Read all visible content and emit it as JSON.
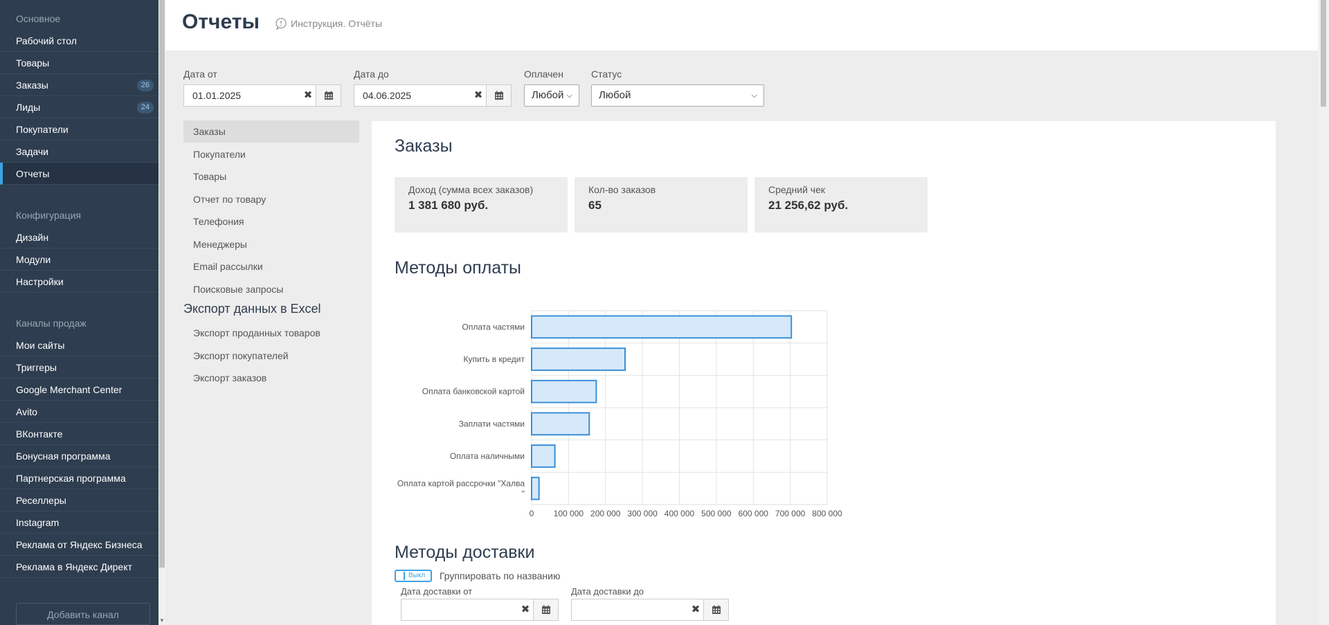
{
  "sidebar": {
    "sections": [
      {
        "title": "Основное",
        "items": [
          {
            "label": "Рабочий стол"
          },
          {
            "label": "Товары"
          },
          {
            "label": "Заказы",
            "badge": "26"
          },
          {
            "label": "Лиды",
            "badge": "24"
          },
          {
            "label": "Покупатели"
          },
          {
            "label": "Задачи"
          },
          {
            "label": "Отчеты",
            "active": true
          }
        ]
      },
      {
        "title": "Конфигурация",
        "items": [
          {
            "label": "Дизайн"
          },
          {
            "label": "Модули"
          },
          {
            "label": "Настройки"
          }
        ]
      },
      {
        "title": "Каналы продаж",
        "items": [
          {
            "label": "Мои сайты"
          },
          {
            "label": "Триггеры"
          },
          {
            "label": "Google Merchant Center"
          },
          {
            "label": "Avito"
          },
          {
            "label": "ВКонтакте"
          },
          {
            "label": "Бонусная программа"
          },
          {
            "label": "Партнерская программа"
          },
          {
            "label": "Реселлеры"
          },
          {
            "label": "Instagram"
          },
          {
            "label": "Реклама от Яндекс Бизнеса"
          },
          {
            "label": "Реклама в Яндекс Директ"
          }
        ]
      }
    ],
    "add_channel": "Добавить канал"
  },
  "header": {
    "title": "Отчеты",
    "help": "Инструкция. Отчёты"
  },
  "filters": {
    "date_from_label": "Дата от",
    "date_from": "01.01.2025",
    "date_to_label": "Дата до",
    "date_to": "04.06.2025",
    "paid_label": "Оплачен",
    "paid_value": "Любой",
    "status_label": "Статус",
    "status_value": "Любой"
  },
  "report_nav": {
    "items": [
      "Заказы",
      "Покупатели",
      "Товары",
      "Отчет по товару",
      "Телефония",
      "Менеджеры",
      "Email рассылки",
      "Поисковые запросы"
    ],
    "active": 0,
    "export_title": "Экспорт данных в Excel",
    "export_items": [
      "Экспорт проданных товаров",
      "Экспорт покупателей",
      "Экспорт заказов"
    ]
  },
  "panel": {
    "title": "Заказы",
    "stats": [
      {
        "title": "Доход (сумма всех заказов)",
        "value": "1 381 680 руб."
      },
      {
        "title": "Кол-во заказов",
        "value": "65"
      },
      {
        "title": "Средний чек",
        "value": "21 256,62 руб."
      }
    ],
    "payment_title": "Методы оплаты",
    "delivery_title": "Методы доставки",
    "toggle_label": "Выкл",
    "group_by_name": "Группировать по названию",
    "delivery_from_label": "Дата доставки от",
    "delivery_to_label": "Дата доставки до"
  },
  "chart_data": {
    "type": "bar",
    "orientation": "horizontal",
    "categories": [
      "Оплата частями",
      "Купить в кредит",
      "Оплата банковской картой",
      "Заплати частями",
      "Оплата наличными",
      "Оплата картой рассрочки \"Халва\""
    ],
    "values": [
      703000,
      253000,
      175000,
      156000,
      63000,
      20000
    ],
    "xlim": [
      0,
      800000
    ],
    "x_ticks": [
      "0",
      "100 000",
      "200 000",
      "300 000",
      "400 000",
      "500 000",
      "600 000",
      "700 000",
      "800 000"
    ],
    "grid": true,
    "colors": {
      "fill": "#d6e9fa",
      "stroke": "#3a8fd6"
    }
  }
}
